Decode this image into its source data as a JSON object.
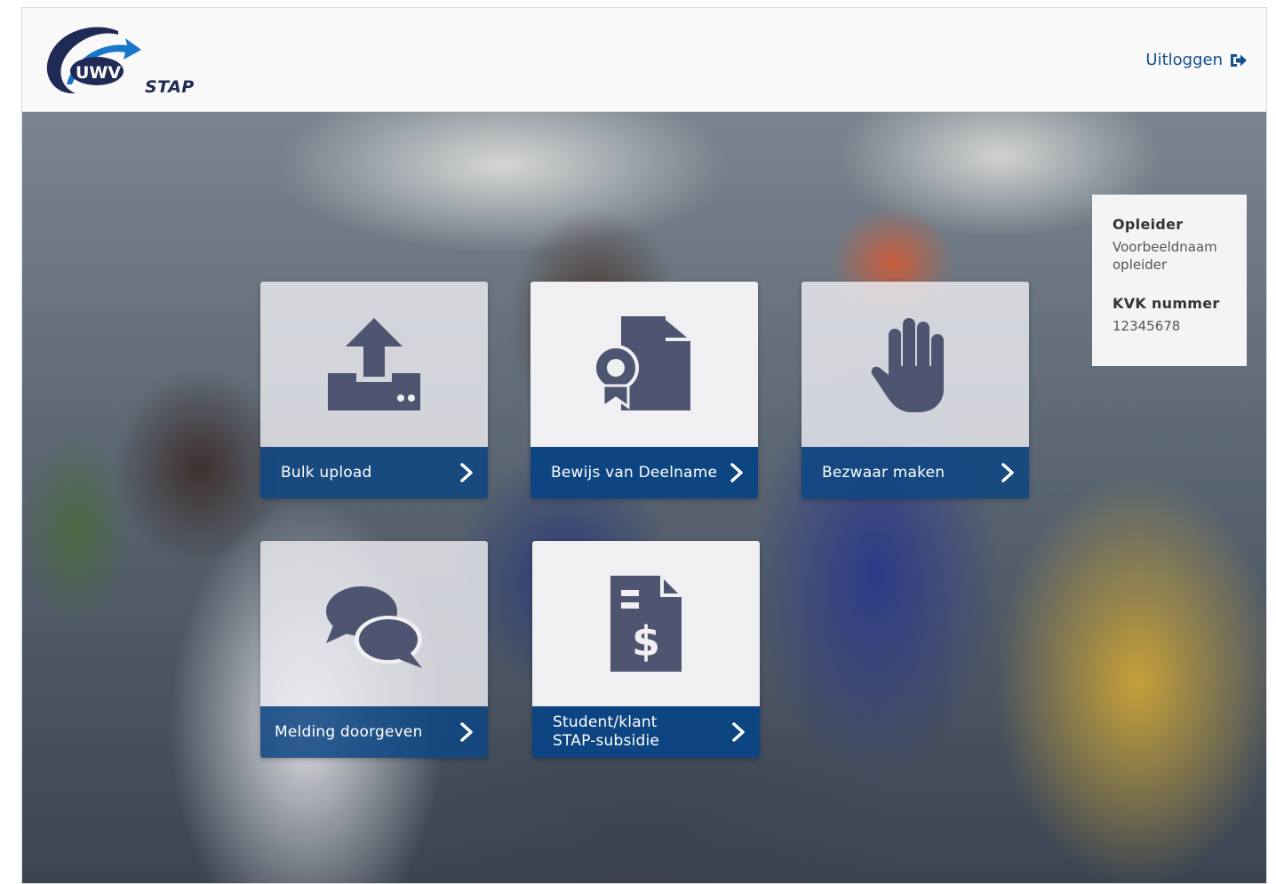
{
  "header": {
    "logo_text": "UWV STAP",
    "logout_label": "Uitloggen"
  },
  "tiles": [
    {
      "label": "Bulk upload",
      "icon": "upload-icon"
    },
    {
      "label": "Bewijs van Deelname",
      "icon": "certificate-icon"
    },
    {
      "label": "Bezwaar maken",
      "icon": "hand-stop-icon"
    },
    {
      "label": "Melding doorgeven",
      "icon": "chat-bubbles-icon"
    },
    {
      "label_line1": "Student/klant",
      "label_line2": "STAP-subsidie",
      "icon": "invoice-dollar-icon"
    }
  ],
  "info_panel": {
    "provider_label": "Opleider",
    "provider_value": "Voorbeeldnaam opleider",
    "kvk_label": "KVK nummer",
    "kvk_value": "12345678"
  },
  "colors": {
    "primary": "#0d4583",
    "icon": "#4e5570",
    "link": "#124f8e",
    "logo_navy": "#1f2a55",
    "logo_blue": "#1976c8"
  }
}
